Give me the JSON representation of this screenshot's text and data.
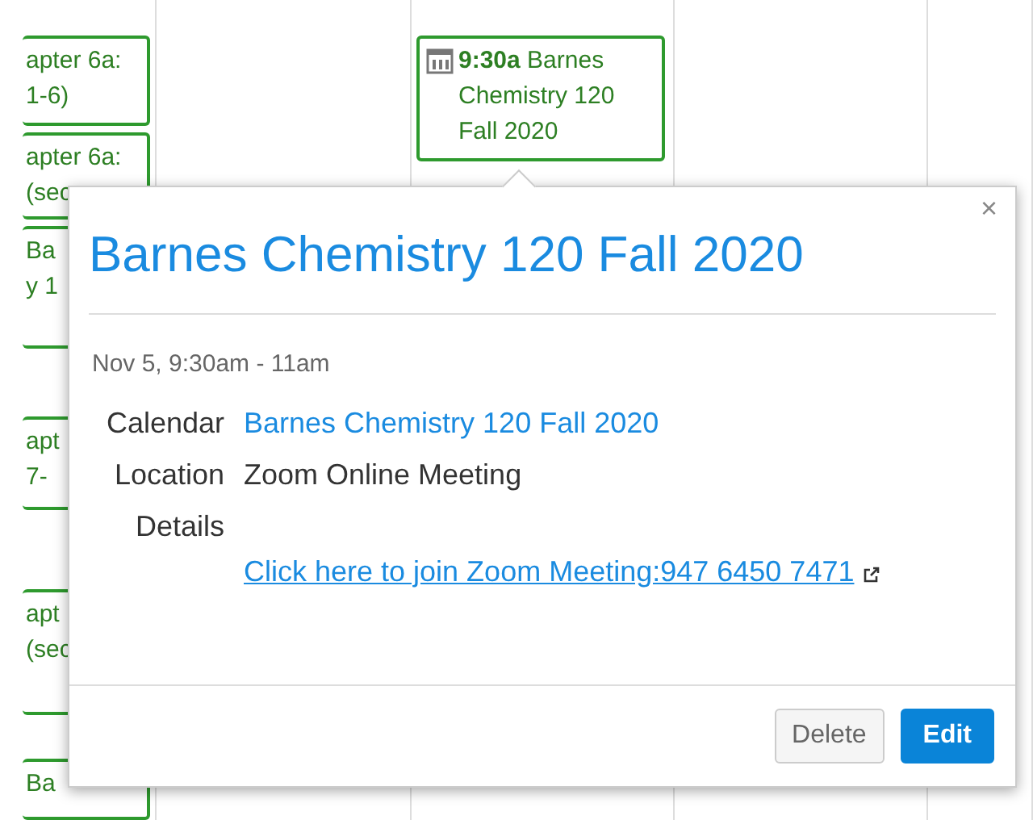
{
  "calendar": {
    "columns": [
      {
        "events": [
          {
            "lines": [
              "apter 6a:",
              "1-6)"
            ]
          },
          {
            "lines": [
              "apter 6a:",
              "(sec"
            ]
          },
          {
            "lines": [
              "Ba",
              "y 1"
            ]
          },
          {
            "lines": [
              "apt",
              "7-"
            ]
          },
          {
            "lines": [
              "apt",
              "(sec"
            ]
          },
          {
            "lines": [
              "Ba"
            ]
          }
        ]
      },
      {},
      {
        "events": [
          {
            "time": "9:30a",
            "title": "Barnes Chemistry 120 Fall 2020"
          }
        ]
      }
    ]
  },
  "popover": {
    "close": "×",
    "title": "Barnes Chemistry 120 Fall 2020",
    "date": "Nov 5, 9:30am - 11am",
    "fields": [
      {
        "label": "Calendar",
        "value": "Barnes Chemistry 120 Fall 2020",
        "kind": "link"
      },
      {
        "label": "Location",
        "value": "Zoom Online Meeting",
        "kind": "text"
      },
      {
        "label": "Details",
        "value": "Click here to join Zoom Meeting:947 6450 7471",
        "kind": "external-link"
      }
    ],
    "buttons": [
      {
        "label": "Delete",
        "kind": "secondary"
      },
      {
        "label": "Edit",
        "kind": "primary"
      }
    ]
  }
}
